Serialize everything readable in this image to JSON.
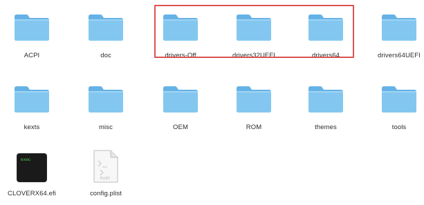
{
  "finder": {
    "row1": [
      {
        "label": "ACPI",
        "icon": "folder-icon"
      },
      {
        "label": "doc",
        "icon": "folder-icon"
      },
      {
        "label": "drivers-Off",
        "icon": "folder-icon"
      },
      {
        "label": "drivers32UEFI",
        "icon": "folder-icon"
      },
      {
        "label": "drivers64",
        "icon": "folder-icon"
      },
      {
        "label": "drivers64UEFI",
        "icon": "folder-icon"
      }
    ],
    "row2": [
      {
        "label": "kexts",
        "icon": "folder-icon"
      },
      {
        "label": "misc",
        "icon": "folder-icon"
      },
      {
        "label": "OEM",
        "icon": "folder-icon"
      },
      {
        "label": "ROM",
        "icon": "folder-icon"
      },
      {
        "label": "themes",
        "icon": "folder-icon"
      },
      {
        "label": "tools",
        "icon": "folder-icon"
      }
    ],
    "row3": [
      {
        "label": "CLOVERX64.efi",
        "icon": "terminal-exec-icon",
        "icon_text": "exec"
      },
      {
        "label": "config.plist",
        "icon": "plist-document-icon",
        "icon_text": "PLIST"
      }
    ]
  },
  "colors": {
    "folder_front": "#7fc4ef",
    "folder_back": "#65b2e6",
    "folder_tab": "#5aa9e0",
    "highlight_border": "#d9534f",
    "label_text": "#2b2b2b"
  }
}
